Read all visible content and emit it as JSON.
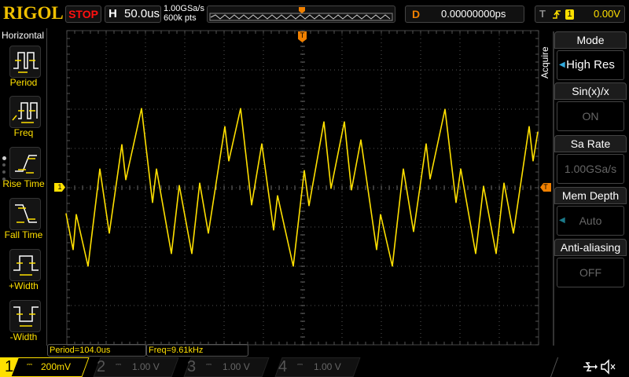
{
  "header": {
    "logo": "RIGOL",
    "run_state": "STOP",
    "horizontal_label": "H",
    "timebase": "50.0us",
    "sample_rate": "1.00GSa/s",
    "memory_depth": "600k pts",
    "delay_label": "D",
    "delay": "0.00000000ps",
    "trigger_label": "T",
    "trigger_source": "1",
    "trigger_level": "0.00V",
    "trigger_edge_icon": "rising-edge-icon"
  },
  "left_menu": {
    "title": "Horizontal",
    "items": [
      {
        "label": "Period",
        "icon": "period-icon"
      },
      {
        "label": "Freq",
        "icon": "freq-icon"
      },
      {
        "label": "Rise Time",
        "icon": "rise-time-icon"
      },
      {
        "label": "Fall Time",
        "icon": "fall-time-icon"
      },
      {
        "label": "+Width",
        "icon": "pos-width-icon"
      },
      {
        "label": "-Width",
        "icon": "neg-width-icon"
      }
    ]
  },
  "measurements": {
    "period": "Period=104.0us",
    "freq": "Freq=9.61kHz"
  },
  "channels": [
    {
      "num": "1",
      "scale": "200mV",
      "color": "#ffe000",
      "active": true
    },
    {
      "num": "2",
      "scale": "1.00 V",
      "color": "#00c0b0",
      "active": false
    },
    {
      "num": "3",
      "scale": "1.00 V",
      "color": "#d040d0",
      "active": false
    },
    {
      "num": "4",
      "scale": "1.00 V",
      "color": "#2080ff",
      "active": false
    }
  ],
  "right_menu": {
    "section": "Acquire",
    "items": [
      {
        "label": "Mode",
        "value": "High Res"
      },
      {
        "label": "Sin(x)/x",
        "value": "ON"
      },
      {
        "label": "Sa Rate",
        "value": "1.00GSa/s"
      },
      {
        "label": "Mem Depth",
        "value": "Auto"
      },
      {
        "label": "Anti-aliasing",
        "value": "OFF"
      }
    ]
  },
  "markers": {
    "ch1": "1",
    "trigger": "T"
  },
  "colors": {
    "ch1": "#ffe000",
    "trigger": "#f08000",
    "stop": "#ff1010"
  },
  "chart_data": {
    "type": "line",
    "x_unit": "us",
    "y_unit": "mV",
    "x_per_div": 50,
    "y_per_div": 200,
    "xlim": [
      -300,
      300
    ],
    "ylim": [
      -800,
      800
    ],
    "grid": true,
    "series": [
      {
        "channel": "1",
        "x": [
          -301,
          -292,
          -288,
          -273,
          -258,
          -246,
          -230,
          -225,
          -205,
          -191,
          -186,
          -167,
          -157,
          -141,
          -131,
          -120,
          -99,
          -94,
          -79,
          -65,
          -52,
          -37,
          -32,
          -12,
          2,
          8,
          27,
          36,
          53,
          62,
          74,
          94,
          99,
          114,
          128,
          141,
          157,
          162,
          181,
          195,
          201,
          220,
          230,
          246,
          256,
          268,
          288,
          293,
          299
        ],
        "y": [
          -132,
          -316,
          -136,
          -400,
          96,
          -232,
          220,
          40,
          404,
          -76,
          96,
          -336,
          12,
          -336,
          24,
          -232,
          312,
          136,
          404,
          -88,
          224,
          -216,
          -40,
          -400,
          88,
          -92,
          336,
          -4,
          336,
          -12,
          244,
          -316,
          -136,
          -400,
          96,
          -224,
          224,
          44,
          400,
          -76,
          96,
          -336,
          8,
          -336,
          24,
          -232,
          312,
          136,
          284
        ]
      }
    ]
  },
  "status": {
    "usb_icon": "usb-icon",
    "sound_icon": "mute-icon"
  }
}
